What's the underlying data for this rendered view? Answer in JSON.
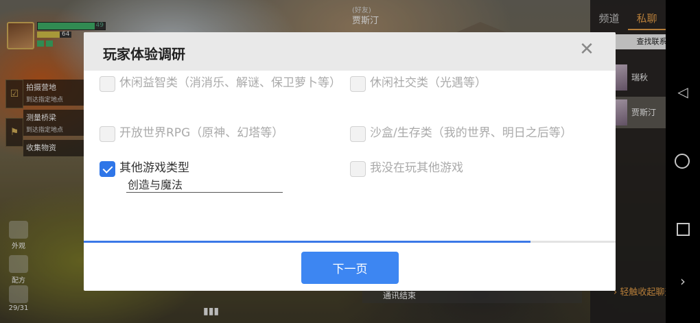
{
  "hud": {
    "hp_value": "49",
    "hp_fraction": 0.85,
    "stamina_value": "64",
    "stamina_fraction": 0.65
  },
  "quests": [
    {
      "title": "拍摄营地",
      "subtitle": "到达指定地点"
    },
    {
      "title": "测量桥梁",
      "subtitle": "到达指定地点"
    },
    {
      "title": "收集物资",
      "subtitle": ""
    }
  ],
  "side_buttons": {
    "appearance": "外观",
    "recipe": "配方",
    "backpack": "29/31"
  },
  "friend_header": {
    "tag": "(好友)",
    "name": "贾斯汀"
  },
  "chat": {
    "tabs": [
      "频道",
      "私聊"
    ],
    "active_tab": "私聊",
    "search_label": "查找联系人",
    "contacts": [
      "瑞秋",
      "贾斯汀"
    ],
    "selected_contact": "贾斯汀",
    "collapse_hint": "轻触收起聊天"
  },
  "call_status": "通讯结束",
  "modal": {
    "title": "玩家体验调研",
    "options": [
      {
        "label": "休闲益智类（消消乐、解谜、保卫萝卜等）",
        "checked": false
      },
      {
        "label": "休闲社交类（光遇等）",
        "checked": false
      },
      {
        "label": "开放世界RPG（原神、幻塔等）",
        "checked": false
      },
      {
        "label": "沙盒/生存类（我的世界、明日之后等）",
        "checked": false
      },
      {
        "label": "其他游戏类型",
        "checked": true
      },
      {
        "label": "我没在玩其他游戏",
        "checked": false
      }
    ],
    "other_input_value": "创造与魔法",
    "progress_fraction": 0.84,
    "next_button": "下一页"
  },
  "colors": {
    "accent_blue": "#3d86f2",
    "chat_accent": "#e8a04a",
    "hp_green": "#3fb36a"
  }
}
